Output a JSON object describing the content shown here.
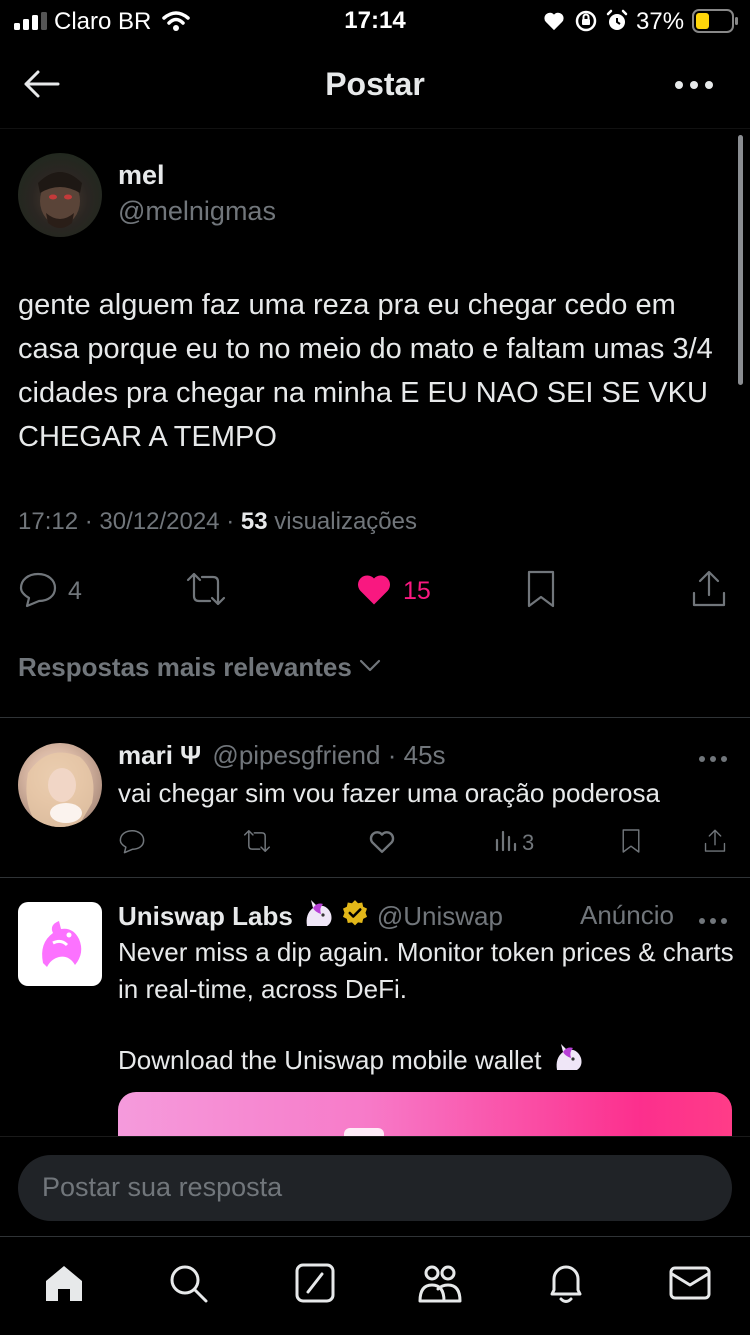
{
  "status_bar": {
    "carrier": "Claro BR",
    "time": "17:14",
    "battery": "37%",
    "battery_level": 0.37
  },
  "header": {
    "title": "Postar"
  },
  "post": {
    "author_name": "mel",
    "author_handle": "@melnigmas",
    "text": "gente alguem faz uma reza pra eu chegar cedo em casa porque eu to no meio do mato e faltam umas 3/4 cidades pra chegar na minha E EU NAO SEI SE VKU CHEGAR A TEMPO",
    "time": "17:12",
    "date": "30/12/2024",
    "views_count": "53",
    "views_label": "visualizações",
    "replies": "4",
    "likes": "15"
  },
  "sort": {
    "label": "Respostas mais relevantes"
  },
  "reply": {
    "author_name": "mari Ψ",
    "author_handle": "@pipesgfriend",
    "age": "45s",
    "text": "vai chegar sim vou fazer uma oração poderosa",
    "views": "3"
  },
  "ad": {
    "author_name": "Uniswap Labs",
    "author_handle": "@Uniswap",
    "ad_label": "Anúncio",
    "text1": "Never miss a dip again. Monitor token prices & charts in real-time, across DeFi.",
    "text2": "Download the Uniswap mobile wallet"
  },
  "composer": {
    "placeholder": "Postar sua resposta"
  },
  "colors": {
    "background": "#000000",
    "text": "#e7e9ea",
    "muted": "#71767b",
    "like": "#f91880",
    "battery": "#ffd60a"
  }
}
